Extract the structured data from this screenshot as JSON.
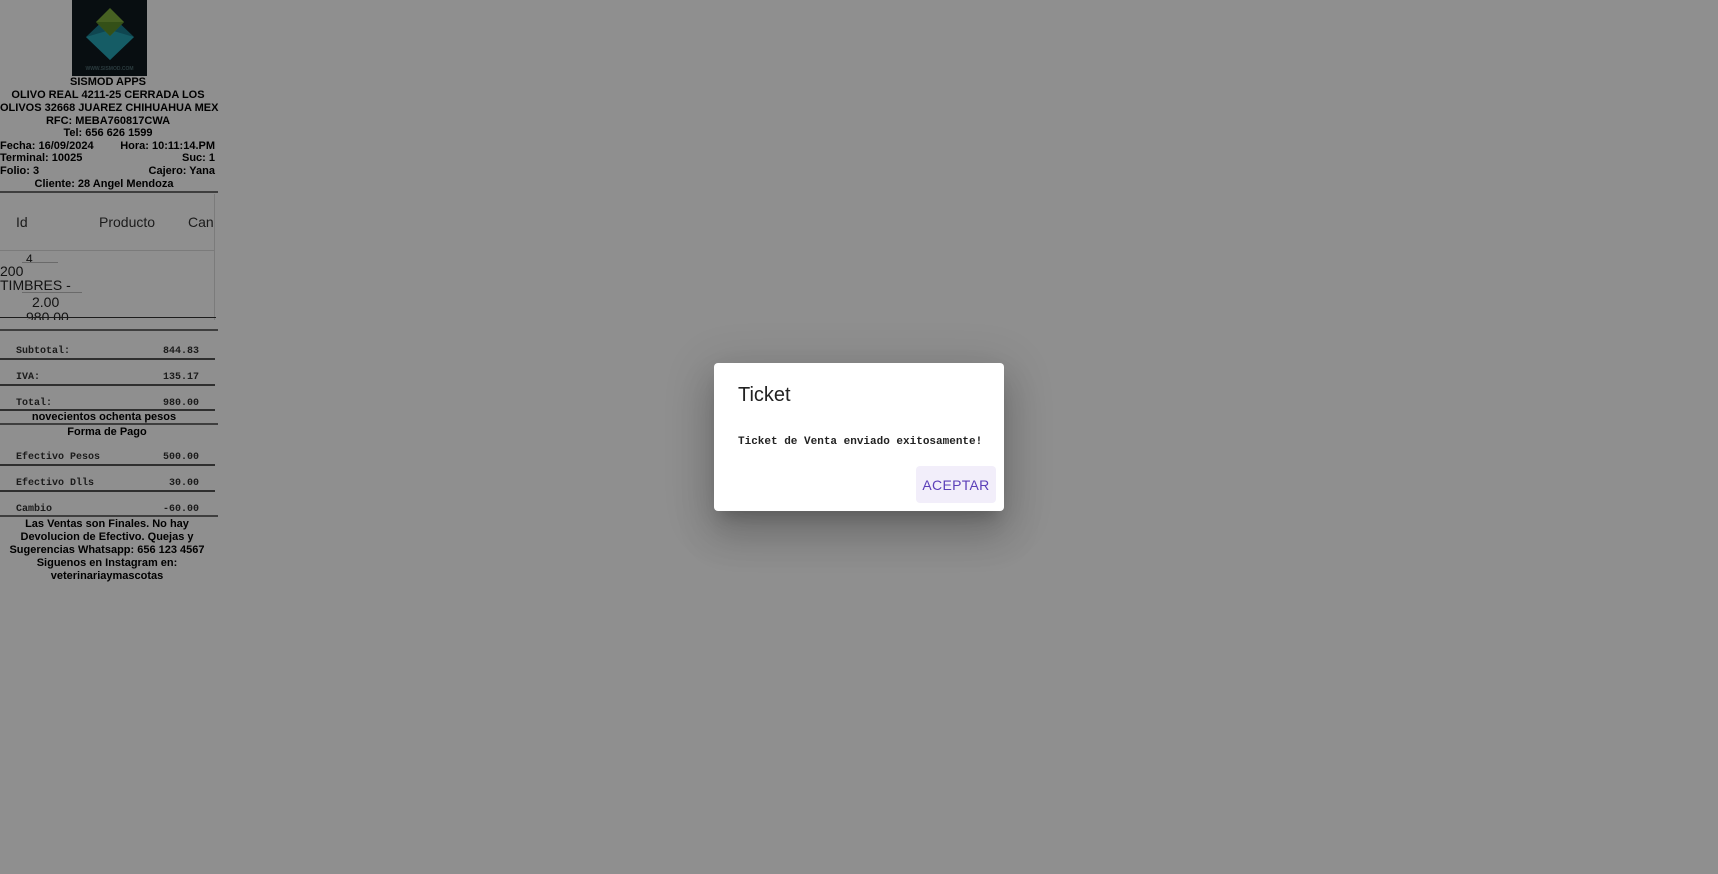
{
  "receipt": {
    "logo_caption": "WWW.SISMOD.COM",
    "company": "SISMOD APPS",
    "address_line1": "OLIVO REAL 4211-25 CERRADA LOS",
    "address_line2": "OLIVOS 32668 JUAREZ CHIHUAHUA MEX",
    "rfc": "RFC: MEBA760817CWA",
    "tel": "Tel: 656 626 1599",
    "fecha": "Fecha: 16/09/2024",
    "hora": "Hora: 10:11:14.PM",
    "terminal": "Terminal: 10025",
    "suc": "Suc: 1",
    "folio": "Folio: 3",
    "cajero": "Cajero: Yana",
    "cliente": "Cliente: 28 Angel Mendoza",
    "table": {
      "headers": [
        "Id",
        "Producto",
        "Can"
      ],
      "row": {
        "id_partial": "4",
        "product_line1": "200",
        "product_line2": "TIMBRES -",
        "qty": "2.00",
        "amount_partial": "980.00"
      }
    },
    "totals": [
      {
        "label": "Subtotal:",
        "value": "844.83"
      },
      {
        "label": "IVA:",
        "value": "135.17"
      },
      {
        "label": "Total:",
        "value": "980.00"
      }
    ],
    "amount_words": "novecientos ochenta pesos",
    "payment_title": "Forma de Pago",
    "payments": [
      {
        "label": "Efectivo Pesos",
        "value": "500.00"
      },
      {
        "label": "Efectivo Dlls",
        "value": "30.00"
      },
      {
        "label": "Cambio",
        "value": "-60.00"
      }
    ],
    "footer_lines": [
      "Las Ventas son Finales. No hay",
      "Devolucion de Efectivo. Quejas y",
      "Sugerencias Whatsapp: 656 123 4567",
      "Siguenos en Instagram en:",
      "veterinariaymascotas"
    ]
  },
  "dialog": {
    "title": "Ticket",
    "message": "Ticket de Venta enviado exitosamente!",
    "accept_label": "ACEPTAR"
  },
  "colors": {
    "scrim": "#000000",
    "accent": "#5b3fb8",
    "button_bg": "#f2eefa"
  }
}
